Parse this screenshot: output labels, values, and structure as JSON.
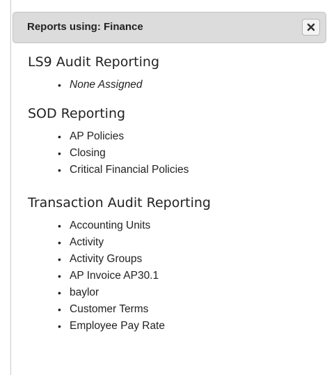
{
  "header": {
    "title": "Reports using: Finance",
    "close_icon": "close-icon"
  },
  "sections": [
    {
      "title": "LS9 Audit Reporting",
      "items": [
        "None Assigned"
      ]
    },
    {
      "title": "SOD Reporting",
      "items": [
        "AP Policies",
        "Closing",
        "Critical Financial Policies"
      ]
    },
    {
      "title": "Transaction Audit Reporting",
      "items": [
        "Accounting Units",
        "Activity",
        "Activity Groups",
        "AP Invoice AP30.1",
        "baylor",
        "Customer Terms",
        "Employee Pay Rate"
      ]
    }
  ]
}
